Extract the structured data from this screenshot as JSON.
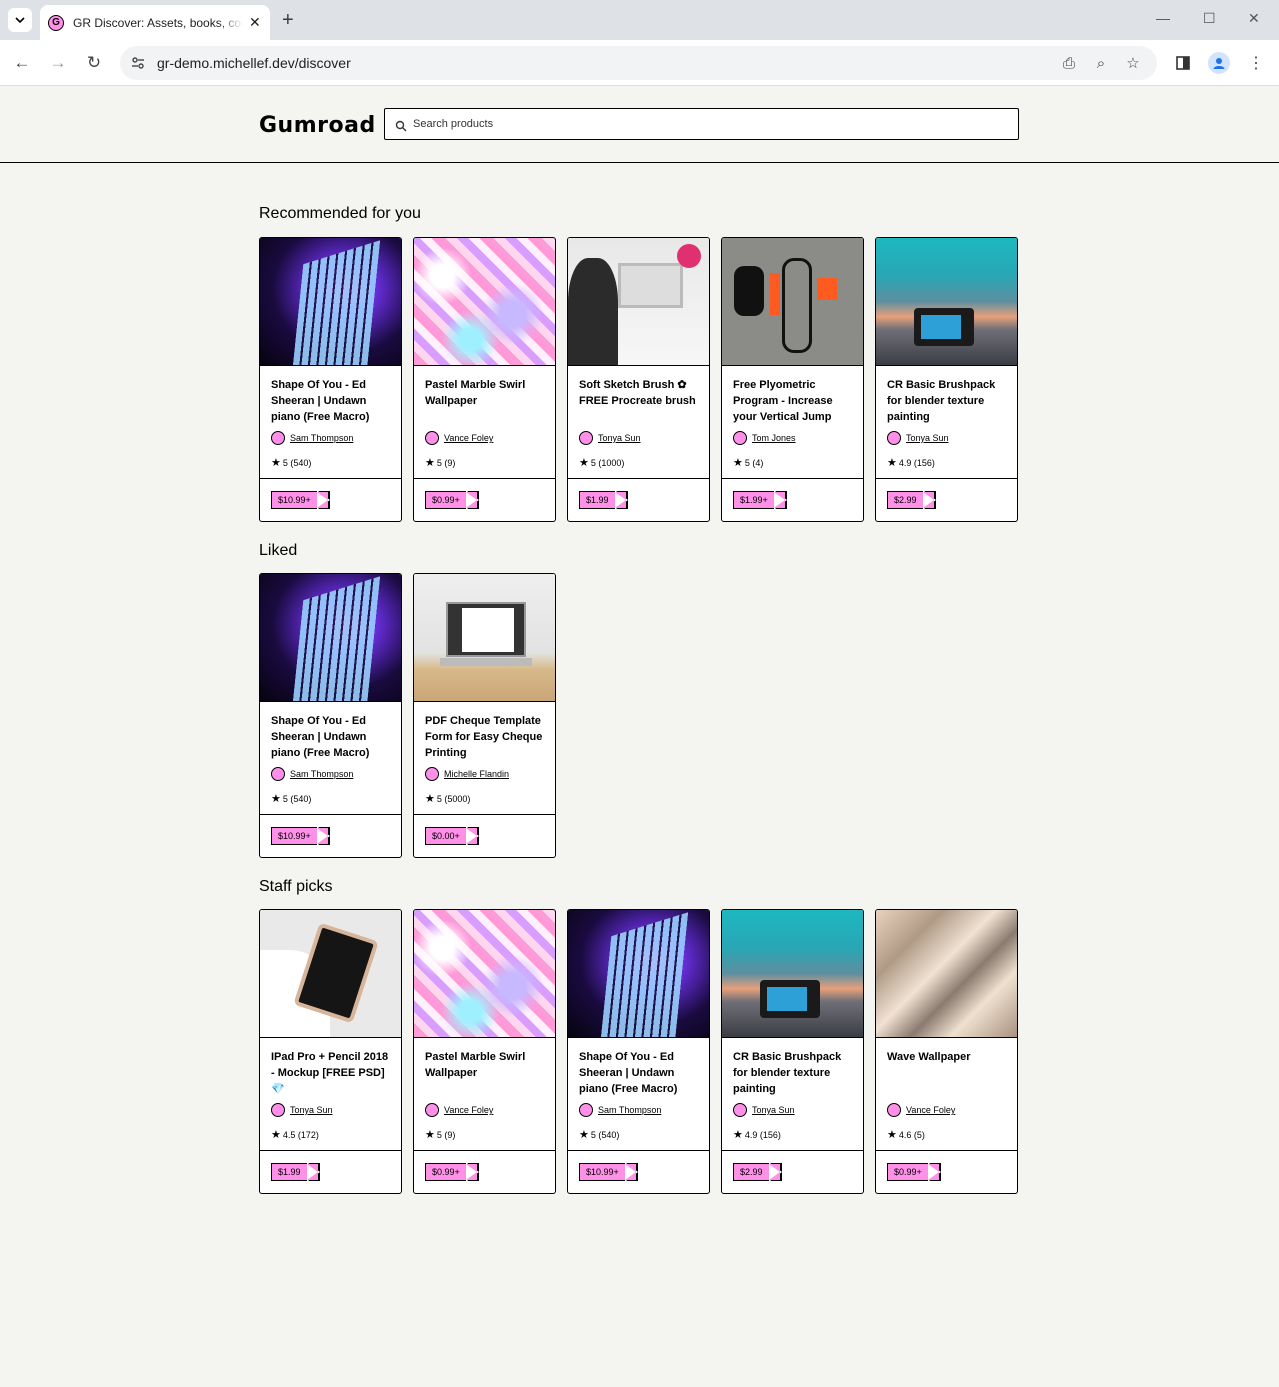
{
  "browser": {
    "tab_title": "GR Discover: Assets, books, courses",
    "url": "gr-demo.michellef.dev/discover"
  },
  "header": {
    "logo": "Gumroad",
    "search_placeholder": "Search products"
  },
  "sections": [
    {
      "title": "Recommended for you",
      "products": [
        {
          "title": "Shape Of You - Ed Sheeran | Undawn piano (Free Macro)",
          "creator": "Sam Thompson",
          "rating": "5 (540)",
          "price": "$10.99+",
          "image": "piano"
        },
        {
          "title": "Pastel Marble Swirl Wallpaper",
          "creator": "Vance Foley",
          "rating": "5 (9)",
          "price": "$0.99+",
          "image": "marble"
        },
        {
          "title": "Soft Sketch Brush ✿ FREE Procreate brush",
          "creator": "Tonya Sun",
          "rating": "5 (1000)",
          "price": "$1.99",
          "image": "laptop-desk"
        },
        {
          "title": "Free Plyometric Program - Increase your Vertical Jump",
          "creator": "Tom Jones",
          "rating": "5 (4)",
          "price": "$1.99+",
          "image": "fitness"
        },
        {
          "title": "CR Basic Brushpack for blender texture painting",
          "creator": "Tonya Sun",
          "rating": "4.9 (156)",
          "price": "$2.99",
          "image": "camera"
        }
      ]
    },
    {
      "title": "Liked",
      "products": [
        {
          "title": "Shape Of You - Ed Sheeran | Undawn piano (Free Macro)",
          "creator": "Sam Thompson",
          "rating": "5 (540)",
          "price": "$10.99+",
          "image": "piano"
        },
        {
          "title": "PDF Cheque Template Form for Easy Cheque Printing",
          "creator": "Michelle Flandin",
          "rating": "5 (5000)",
          "price": "$0.00+",
          "image": "macbook"
        }
      ]
    },
    {
      "title": "Staff picks",
      "products": [
        {
          "title": "IPad Pro + Pencil 2018 - Mockup [FREE PSD] 💎",
          "creator": "Tonya Sun",
          "rating": "4.5 (172)",
          "price": "$1.99",
          "image": "ipad"
        },
        {
          "title": "Pastel Marble Swirl Wallpaper",
          "creator": "Vance Foley",
          "rating": "5 (9)",
          "price": "$0.99+",
          "image": "marble"
        },
        {
          "title": "Shape Of You - Ed Sheeran | Undawn piano (Free Macro)",
          "creator": "Sam Thompson",
          "rating": "5 (540)",
          "price": "$10.99+",
          "image": "piano"
        },
        {
          "title": "CR Basic Brushpack for blender texture painting",
          "creator": "Tonya Sun",
          "rating": "4.9 (156)",
          "price": "$2.99",
          "image": "camera"
        },
        {
          "title": "Wave Wallpaper",
          "creator": "Vance Foley",
          "rating": "4.6 (5)",
          "price": "$0.99+",
          "image": "wave"
        }
      ]
    }
  ],
  "colors": {
    "accent": "#ff90e8",
    "background": "#f4f4f0",
    "border": "#000000"
  }
}
